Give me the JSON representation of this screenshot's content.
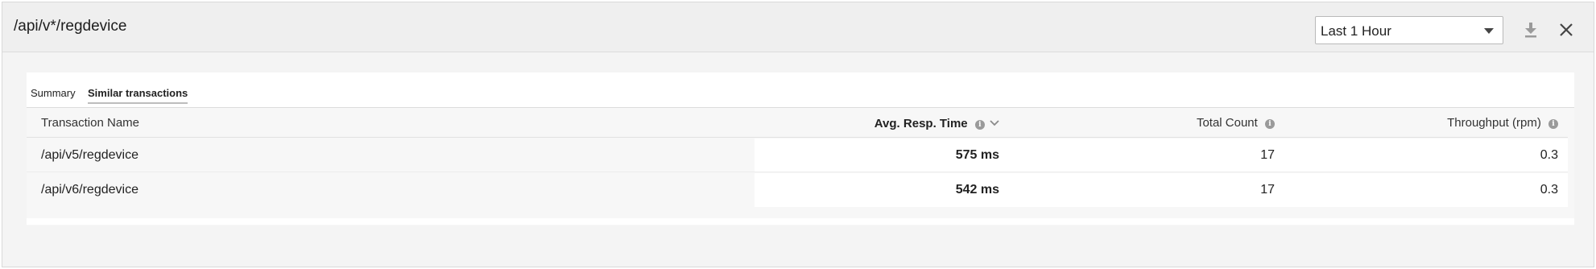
{
  "header": {
    "title": "/api/v*/regdevice",
    "time_range": "Last 1 Hour",
    "download_icon": "download-icon",
    "close_icon": "close-icon"
  },
  "tabs": [
    {
      "label": "Summary",
      "active": false
    },
    {
      "label": "Similar transactions",
      "active": true
    }
  ],
  "table": {
    "columns": {
      "name": "Transaction Name",
      "avg_resp_time": "Avg. Resp. Time",
      "total_count": "Total Count",
      "throughput": "Throughput (rpm)"
    },
    "sorted_by": "avg_resp_time",
    "sort_direction": "desc",
    "rows": [
      {
        "name": "/api/v5/regdevice",
        "avg_resp_time": "575 ms",
        "total_count": "17",
        "throughput": "0.3"
      },
      {
        "name": "/api/v6/regdevice",
        "avg_resp_time": "542 ms",
        "total_count": "17",
        "throughput": "0.3"
      }
    ]
  },
  "colors": {
    "header_bg": "#efefef",
    "panel_bg": "#f4f4f4",
    "highlight_bg": "#ffffff"
  }
}
